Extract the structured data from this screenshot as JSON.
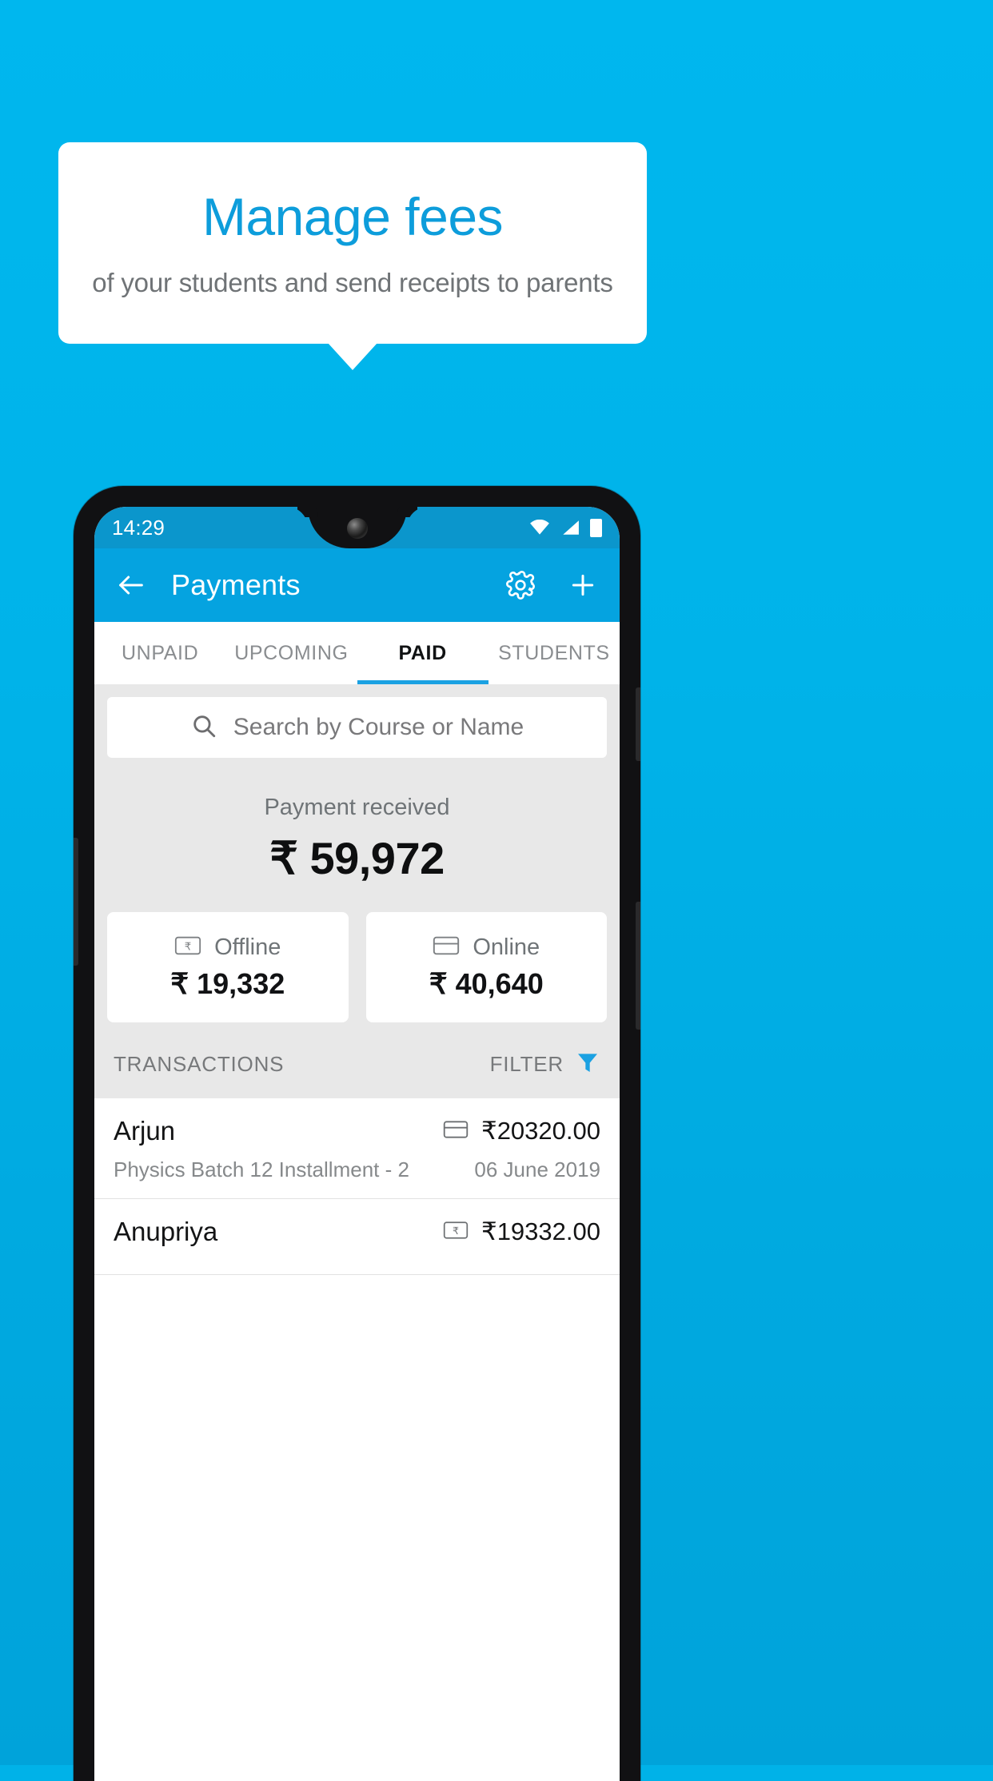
{
  "theme": {
    "background": "#00b2e8",
    "brand_blue": "#0d9ddb",
    "appbar_blue": "#05a3e0",
    "statusbar_blue": "#0b96cc",
    "accent": "#1ba1e2"
  },
  "callout": {
    "title": "Manage fees",
    "subtitle": "of your students and send receipts to parents"
  },
  "phone": {
    "statusbar": {
      "time": "14:29",
      "icons": [
        "wifi-icon",
        "signal-icon",
        "battery-icon"
      ]
    },
    "appbar": {
      "back_icon": "arrow-left-icon",
      "title": "Payments",
      "settings_icon": "gear-icon",
      "add_icon": "plus-icon"
    },
    "tabs": [
      {
        "label": "UNPAID",
        "active": false
      },
      {
        "label": "UPCOMING",
        "active": false
      },
      {
        "label": "PAID",
        "active": true
      },
      {
        "label": "STUDENTS",
        "active": false
      }
    ],
    "search": {
      "icon": "search-icon",
      "placeholder": "Search by Course or Name",
      "value": ""
    },
    "summary": {
      "label": "Payment received",
      "amount": "₹ 59,972"
    },
    "modes": [
      {
        "icon": "rupee-note-icon",
        "name": "Offline",
        "amount": "₹ 19,332"
      },
      {
        "icon": "credit-card-icon",
        "name": "Online",
        "amount": "₹ 40,640"
      }
    ],
    "transactions_header": {
      "title": "TRANSACTIONS",
      "filter_label": "FILTER",
      "filter_icon": "funnel-icon"
    },
    "transactions": [
      {
        "name": "Arjun",
        "description": "Physics Batch 12 Installment - 2",
        "amount": "₹20320.00",
        "date": "06 June 2019",
        "method_icon": "credit-card-icon"
      },
      {
        "name": "Anupriya",
        "description": "",
        "amount": "₹19332.00",
        "date": "",
        "method_icon": "rupee-note-icon"
      }
    ]
  }
}
